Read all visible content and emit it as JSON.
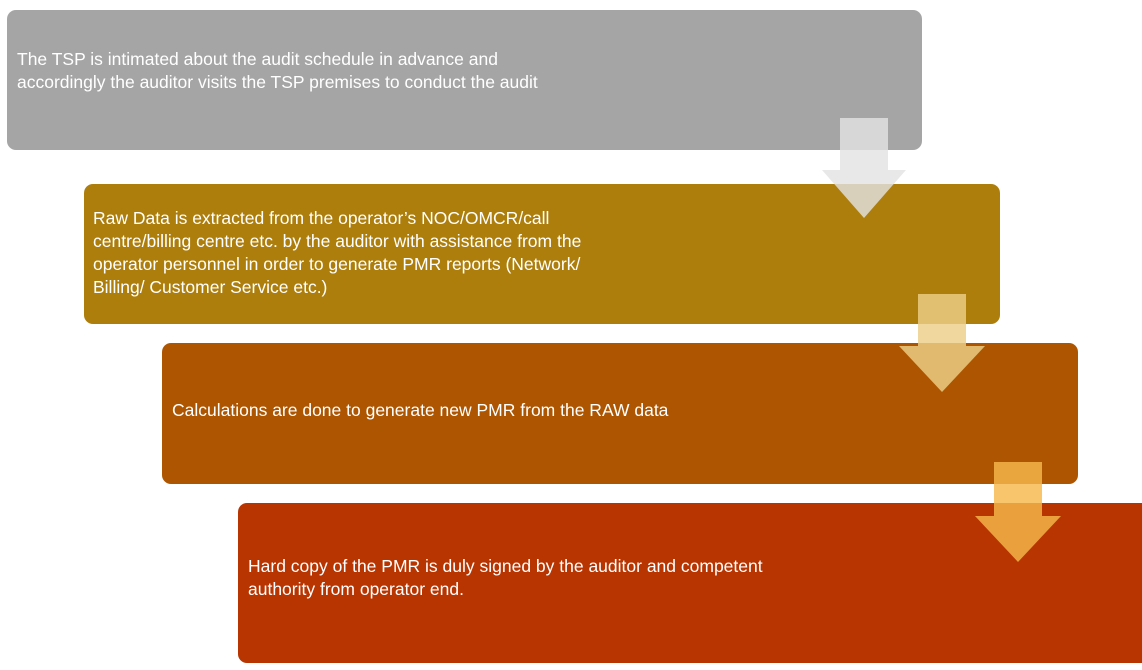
{
  "steps": [
    {
      "text": "The TSP is intimated  about the audit schedule in advance and\naccordingly the auditor visits the TSP premises to conduct the audit",
      "color": "#a5a5a5"
    },
    {
      "text": "Raw Data is extracted  from the operator’s NOC/OMCR/call\ncentre/billing  centre etc. by the auditor with assistance from the\noperator personnel in order to generate PMR reports (Network/\nBilling/ Customer  Service etc.)",
      "color": "#ad7e0c"
    },
    {
      "text": "Calculations  are done to generate  new PMR from the RAW data",
      "color": "#ad5500"
    },
    {
      "text": "Hard copy of the PMR is duly signed by the auditor and competent\nauthority from operator end.",
      "color": "#b83400"
    }
  ],
  "arrows": [
    {
      "color": "#e3e3e3"
    },
    {
      "color": "#edcf88"
    },
    {
      "color": "#f7b84c"
    }
  ]
}
